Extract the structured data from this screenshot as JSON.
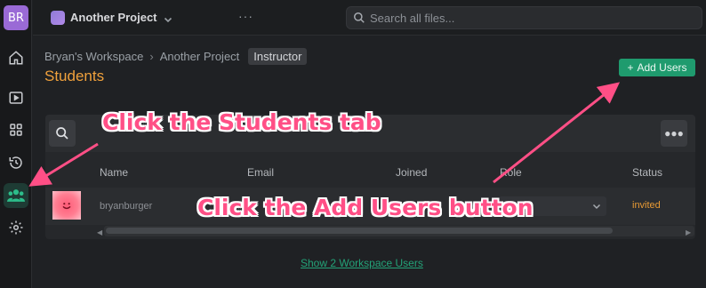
{
  "rail": {
    "avatar_initials": "BR",
    "items": [
      {
        "icon": "home-icon"
      },
      {
        "icon": "play-icon"
      },
      {
        "icon": "grid-icon"
      },
      {
        "icon": "history-icon"
      },
      {
        "icon": "students-icon",
        "active": true
      },
      {
        "icon": "gear-icon"
      }
    ]
  },
  "topbar": {
    "project_name": "Another Project",
    "search_placeholder": "Search all files..."
  },
  "breadcrumb": {
    "workspace": "Bryan's Workspace",
    "project": "Another Project",
    "role_pill": "Instructor"
  },
  "page": {
    "title": "Students",
    "add_users_label": "Add Users"
  },
  "table": {
    "columns": [
      "Name",
      "Email",
      "Joined",
      "Role",
      "Status"
    ],
    "rows": [
      {
        "name": "bryanburger",
        "email": "",
        "joined": "",
        "role": "",
        "status": "invited"
      }
    ]
  },
  "footer": {
    "workspace_link": "Show 2 Workspace Users"
  },
  "annotations": {
    "students_tab_callout": "Click the Students tab",
    "add_users_callout": "Click the Add Users button"
  },
  "colors": {
    "accent_orange": "#f0a13c",
    "primary_green": "#1f9b6e",
    "annotation_pink": "#ff4f86"
  }
}
